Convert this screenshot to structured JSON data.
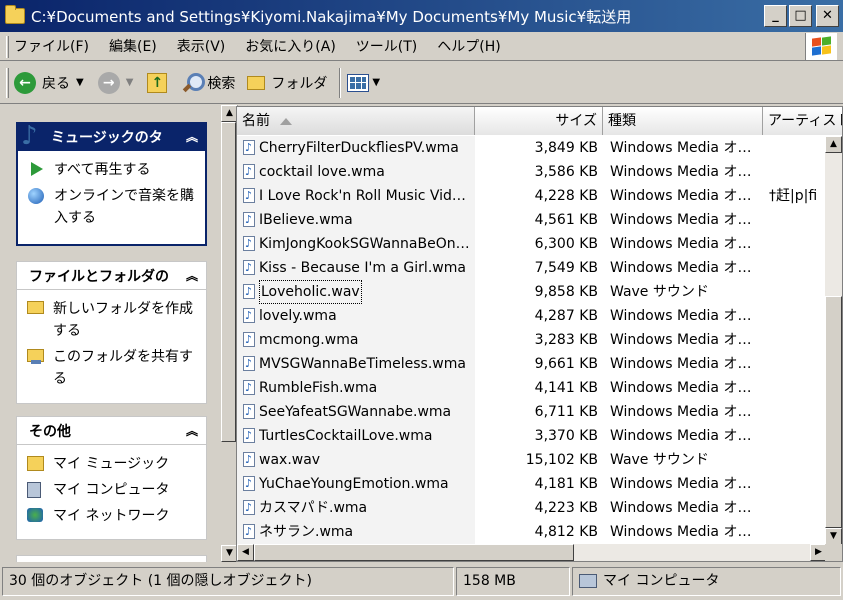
{
  "window": {
    "title": "C:¥Documents and Settings¥Kiyomi.Nakajima¥My Documents¥My Music¥転送用",
    "minimize": "_",
    "maximize": "□",
    "close": "✕"
  },
  "menu": [
    "ファイル(F)",
    "編集(E)",
    "表示(V)",
    "お気に入り(A)",
    "ツール(T)",
    "ヘルプ(H)"
  ],
  "toolbar": {
    "back": "戻る",
    "search": "検索",
    "folders": "フォルダ"
  },
  "taskpane": {
    "music_tasks": {
      "title": "ミュージックのタ",
      "items": [
        "すべて再生する",
        "オンラインで音楽を購入する"
      ]
    },
    "file_tasks": {
      "title": "ファイルとフォルダの",
      "items": [
        "新しいフォルダを作成する",
        "このフォルダを共有する"
      ]
    },
    "other": {
      "title": "その他",
      "items": [
        "マイ ミュージック",
        "マイ コンピュータ",
        "マイ ネットワーク"
      ]
    }
  },
  "columns": {
    "name": "名前",
    "size": "サイズ",
    "type": "種類",
    "artist": "アーティスト"
  },
  "files": [
    {
      "name": "CherryFilterDuckfliesPV.wma",
      "size": "3,849 KB",
      "type": "Windows Media オーディオ",
      "artist": ""
    },
    {
      "name": "cocktail love.wma",
      "size": "3,586 KB",
      "type": "Windows Media オーディオ",
      "artist": ""
    },
    {
      "name": "I Love Rock'n Roll Music Video.wma",
      "size": "4,228 KB",
      "type": "Windows Media オーディオ",
      "artist": "†赶|p|fi"
    },
    {
      "name": "IBelieve.wma",
      "size": "4,561 KB",
      "type": "Windows Media オーディオ",
      "artist": ""
    },
    {
      "name": "KimJongKookSGWannaBeOne.wma",
      "size": "6,300 KB",
      "type": "Windows Media オーディオ",
      "artist": ""
    },
    {
      "name": "Kiss - Because I'm a Girl.wma",
      "size": "7,549 KB",
      "type": "Windows Media オーディオ",
      "artist": ""
    },
    {
      "name": "Loveholic.wav",
      "size": "9,858 KB",
      "type": "Wave サウンド",
      "artist": ""
    },
    {
      "name": "lovely.wma",
      "size": "4,287 KB",
      "type": "Windows Media オーディオ",
      "artist": ""
    },
    {
      "name": "mcmong.wma",
      "size": "3,283 KB",
      "type": "Windows Media オーディオ",
      "artist": ""
    },
    {
      "name": "MVSGWannaBeTimeless.wma",
      "size": "9,661 KB",
      "type": "Windows Media オーディオ",
      "artist": ""
    },
    {
      "name": "RumbleFish.wma",
      "size": "4,141 KB",
      "type": "Windows Media オーディオ",
      "artist": ""
    },
    {
      "name": "SeeYafeatSGWannabe.wma",
      "size": "6,711 KB",
      "type": "Windows Media オーディオ",
      "artist": ""
    },
    {
      "name": "TurtlesCocktailLove.wma",
      "size": "3,370 KB",
      "type": "Windows Media オーディオ",
      "artist": ""
    },
    {
      "name": "wax.wav",
      "size": "15,102 KB",
      "type": "Wave サウンド",
      "artist": ""
    },
    {
      "name": "YuChaeYoungEmotion.wma",
      "size": "4,181 KB",
      "type": "Windows Media オーディオ",
      "artist": ""
    },
    {
      "name": "カスマパド.wma",
      "size": "4,223 KB",
      "type": "Windows Media オーディオ",
      "artist": ""
    },
    {
      "name": "ネサラン.wma",
      "size": "4,812 KB",
      "type": "Windows Media オーディオ",
      "artist": ""
    }
  ],
  "selected_index": 6,
  "status": {
    "objects": "30 個のオブジェクト (1 個の隠しオブジェクト)",
    "size": "158 MB",
    "location": "マイ コンピュータ"
  }
}
